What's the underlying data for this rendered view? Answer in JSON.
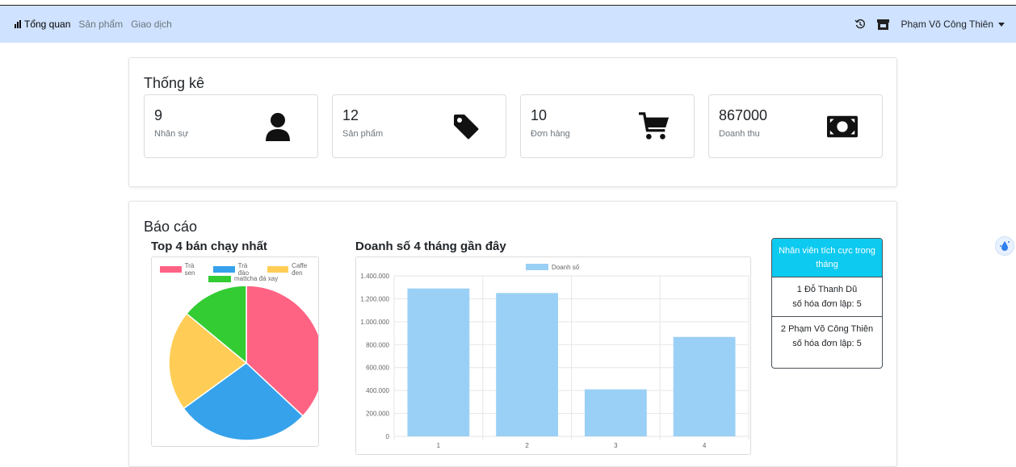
{
  "navbar": {
    "brand_label": "Tổng quan",
    "links": [
      "Sản phẩm",
      "Giao dịch"
    ],
    "user_name": "Phạm Võ Công Thiên"
  },
  "stats": {
    "title": "Thống kê",
    "items": [
      {
        "value": "9",
        "label": "Nhân sự",
        "icon": "user-icon"
      },
      {
        "value": "12",
        "label": "Sản phẩm",
        "icon": "tag-icon"
      },
      {
        "value": "10",
        "label": "Đơn hàng",
        "icon": "cart-icon"
      },
      {
        "value": "867000",
        "label": "Doanh thu",
        "icon": "money-icon"
      }
    ]
  },
  "report": {
    "title": "Báo cáo",
    "pie_title": "Top 4 bán chạy nhất",
    "bar_title": "Doanh số 4 tháng gần đây",
    "employees": {
      "header": "Nhân viên tích cực trong tháng",
      "rows": [
        {
          "line1": "1 Đỗ Thanh Dũ",
          "line2": "số hóa đơn lập: 5"
        },
        {
          "line1": "2 Phạm Võ Công Thiên",
          "line2": "số hóa đơn lập: 5"
        }
      ]
    }
  },
  "colors": {
    "navbar_bg": "#cfe2ff",
    "pie": [
      "#ff6384",
      "#36a2eb",
      "#ffcd56",
      "#33cc33"
    ],
    "bar": "#9ad0f5",
    "emp_header": "#0dcaf0"
  },
  "chart_data": [
    {
      "type": "pie",
      "title": "Top 4 bán chạy nhất",
      "categories": [
        "Trà sen",
        "Trà đào",
        "Caffe đen",
        "mattcha đá xay"
      ],
      "values": [
        37,
        28,
        21,
        14
      ],
      "legend": "top"
    },
    {
      "type": "bar",
      "title": "Doanh số 4 tháng gần đây",
      "categories": [
        "1",
        "2",
        "3",
        "4"
      ],
      "series": [
        {
          "name": "Doanh số",
          "values": [
            1290000,
            1250000,
            410000,
            867000
          ]
        }
      ],
      "ylim": [
        0,
        1400000
      ],
      "yticks": [
        "0",
        "200.000",
        "400.000",
        "600.000",
        "800.000",
        "1.000.000",
        "1.200.000",
        "1.400.000"
      ],
      "grid": true,
      "legend": "top"
    }
  ]
}
